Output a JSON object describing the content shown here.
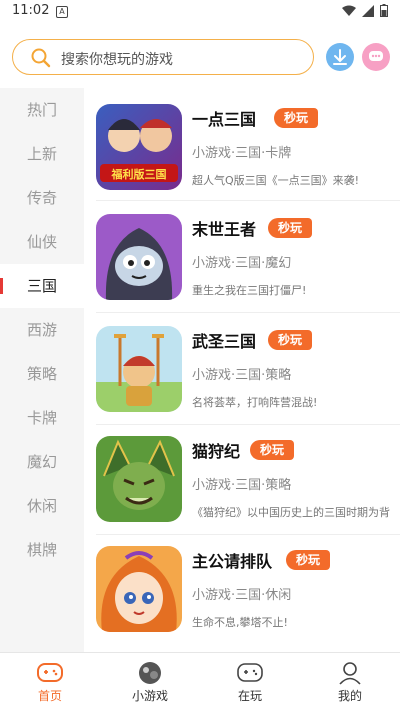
{
  "status": {
    "time": "11:02",
    "a_icon": "A"
  },
  "search": {
    "placeholder": "搜索你想玩的游戏"
  },
  "sidebar": {
    "items": [
      {
        "label": "热门"
      },
      {
        "label": "上新"
      },
      {
        "label": "传奇"
      },
      {
        "label": "仙侠"
      },
      {
        "label": "三国",
        "active": true
      },
      {
        "label": "西游"
      },
      {
        "label": "策略"
      },
      {
        "label": "卡牌"
      },
      {
        "label": "魔幻"
      },
      {
        "label": "休闲"
      },
      {
        "label": "棋牌"
      }
    ]
  },
  "games": [
    {
      "name": "一点三国",
      "badge": "秒玩",
      "tags": "小游戏·三国·卡牌",
      "desc": "超人气Q版三国《一点三国》来袭!",
      "icon_text": "福利版三国"
    },
    {
      "name": "末世王者",
      "badge": "秒玩",
      "tags": "小游戏·三国·魔幻",
      "desc": "重生之我在三国打僵尸!"
    },
    {
      "name": "武圣三国",
      "badge": "秒玩",
      "tags": "小游戏·三国·策略",
      "desc": "名将荟萃，打响阵营混战!"
    },
    {
      "name": "猫狩纪",
      "badge": "秒玩",
      "tags": "小游戏·三国·策略",
      "desc": "《猫狩纪》以中国历史上的三国时期为背"
    },
    {
      "name": "主公请排队",
      "badge": "秒玩",
      "tags": "小游戏·三国·休闲",
      "desc": "生命不息,攀塔不止!"
    }
  ],
  "nav": {
    "items": [
      {
        "label": "首页",
        "active": true
      },
      {
        "label": "小游戏"
      },
      {
        "label": "在玩"
      },
      {
        "label": "我的"
      }
    ]
  },
  "colors": {
    "accent": "#f36b2a",
    "search_border": "#f4b04a",
    "active_bar": "#e53935"
  }
}
